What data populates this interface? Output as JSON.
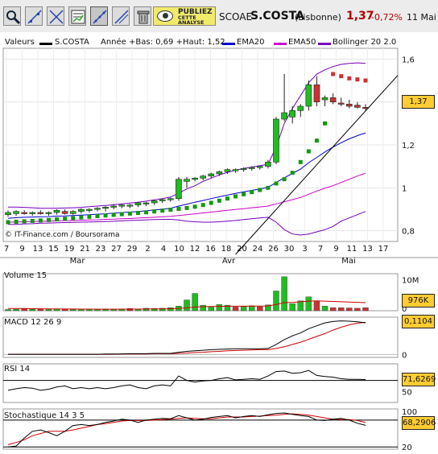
{
  "toolbar": {
    "buttons": [
      {
        "name": "zoom-tool-button",
        "icon": "magnifier-icon",
        "active": false
      },
      {
        "name": "draw-trendline-button",
        "icon": "trendline-icon",
        "active": false
      },
      {
        "name": "draw-cross-line-button",
        "icon": "cross-lines-icon",
        "active": false
      },
      {
        "name": "indicator-chart-button",
        "icon": "chart-percent-icon",
        "active": false
      },
      {
        "name": "trendline-mode-button",
        "icon": "trendline-dots-icon",
        "active": true
      },
      {
        "name": "draw-line-button",
        "icon": "line-icon",
        "active": false
      },
      {
        "name": "delete-button",
        "icon": "trash-icon",
        "active": false
      }
    ],
    "publish_line1": "PUBLIEZ",
    "publish_line2": "CETTE",
    "publish_line3": "ANALYSE"
  },
  "header": {
    "code": "SCOAE",
    "name": "S.COSTA",
    "exchange": "(Lisbonne)",
    "price": "1,37",
    "change": "-0,72%",
    "date": "11 Mai"
  },
  "legend": {
    "valeurs": "Valeurs",
    "series": "S.COSTA",
    "range": "Année +Bas: 0,69 +Haut: 1,52",
    "ema20": "EMA20",
    "ema50": "EMA50",
    "bollinger": "Bollinger 20 2.0"
  },
  "credit": "© IT-Finance.com / Boursorama",
  "colors": {
    "up": "#22bb22",
    "down": "#cc3333",
    "sar_up": "#119911",
    "sar_down": "#cc3333",
    "ema20": "#0000cc",
    "ema50": "#cc00cc",
    "bollinger": "#7700bb",
    "trend": "#000000",
    "vol_ma": "#cc0000",
    "indicator": "#000000",
    "signal": "#cc0000"
  },
  "chart_data": [
    {
      "type": "candlestick",
      "title": "S.COSTA",
      "x_ticks": [
        "7",
        "9",
        "13",
        "15",
        "19",
        "21",
        "23",
        "27",
        "29",
        "2",
        "4",
        "10",
        "12",
        "16",
        "18",
        "20",
        "24",
        "26",
        "30",
        "3",
        "7",
        "9",
        "11",
        "13",
        "17"
      ],
      "months": [
        "Mar",
        "Avr",
        "Mai"
      ],
      "ylim": [
        0.75,
        1.65
      ],
      "y_ticks": [
        "0,8",
        "1",
        "1,2",
        "1,4",
        "1,6"
      ],
      "last_value": "1,37",
      "ohlc": [
        [
          0.875,
          0.895,
          0.865,
          0.885
        ],
        [
          0.88,
          0.895,
          0.87,
          0.89
        ],
        [
          0.885,
          0.895,
          0.875,
          0.88
        ],
        [
          0.88,
          0.89,
          0.87,
          0.885
        ],
        [
          0.885,
          0.895,
          0.875,
          0.88
        ],
        [
          0.88,
          0.89,
          0.87,
          0.885
        ],
        [
          0.885,
          0.9,
          0.875,
          0.895
        ],
        [
          0.89,
          0.9,
          0.875,
          0.88
        ],
        [
          0.88,
          0.895,
          0.875,
          0.89
        ],
        [
          0.89,
          0.905,
          0.88,
          0.9
        ],
        [
          0.895,
          0.905,
          0.885,
          0.9
        ],
        [
          0.9,
          0.91,
          0.89,
          0.905
        ],
        [
          0.905,
          0.915,
          0.89,
          0.91
        ],
        [
          0.91,
          0.925,
          0.9,
          0.915
        ],
        [
          0.915,
          0.925,
          0.905,
          0.92
        ],
        [
          0.915,
          0.925,
          0.905,
          0.92
        ],
        [
          0.92,
          0.935,
          0.91,
          0.93
        ],
        [
          0.925,
          0.935,
          0.915,
          0.93
        ],
        [
          0.93,
          0.945,
          0.92,
          0.94
        ],
        [
          0.94,
          0.95,
          0.93,
          0.945
        ],
        [
          0.945,
          0.955,
          0.935,
          0.95
        ],
        [
          0.95,
          1.05,
          0.94,
          1.04
        ],
        [
          1.03,
          1.05,
          1.0,
          1.04
        ],
        [
          1.04,
          1.05,
          1.03,
          1.045
        ],
        [
          1.045,
          1.06,
          1.035,
          1.055
        ],
        [
          1.055,
          1.07,
          1.045,
          1.065
        ],
        [
          1.065,
          1.08,
          1.055,
          1.075
        ],
        [
          1.075,
          1.09,
          1.065,
          1.085
        ],
        [
          1.08,
          1.09,
          1.07,
          1.085
        ],
        [
          1.085,
          1.095,
          1.075,
          1.09
        ],
        [
          1.09,
          1.1,
          1.08,
          1.095
        ],
        [
          1.095,
          1.1,
          1.085,
          1.1
        ],
        [
          1.1,
          1.13,
          1.09,
          1.12
        ],
        [
          1.12,
          1.33,
          1.11,
          1.32
        ],
        [
          1.32,
          1.53,
          1.31,
          1.35
        ],
        [
          1.33,
          1.38,
          1.3,
          1.36
        ],
        [
          1.36,
          1.39,
          1.33,
          1.38
        ],
        [
          1.38,
          1.5,
          1.36,
          1.48
        ],
        [
          1.48,
          1.52,
          1.38,
          1.4
        ],
        [
          1.41,
          1.43,
          1.38,
          1.42
        ],
        [
          1.42,
          1.44,
          1.39,
          1.4
        ],
        [
          1.395,
          1.42,
          1.38,
          1.39
        ],
        [
          1.39,
          1.41,
          1.37,
          1.38
        ],
        [
          1.385,
          1.4,
          1.37,
          1.375
        ],
        [
          1.375,
          1.39,
          1.36,
          1.37
        ]
      ],
      "sar": [
        0.84,
        0.842,
        0.844,
        0.846,
        0.848,
        0.85,
        0.853,
        0.856,
        0.859,
        0.862,
        0.865,
        0.868,
        0.871,
        0.874,
        0.877,
        0.88,
        0.883,
        0.886,
        0.89,
        0.894,
        0.898,
        0.902,
        0.906,
        0.912,
        0.92,
        0.93,
        0.94,
        0.95,
        0.96,
        0.97,
        0.98,
        0.99,
        1.0,
        1.02,
        1.04,
        1.07,
        1.12,
        1.17,
        1.22,
        1.3,
        1.53,
        1.52,
        1.51,
        1.505,
        1.5
      ],
      "ema20": [
        0.858,
        0.861,
        0.863,
        0.864,
        0.865,
        0.866,
        0.868,
        0.869,
        0.871,
        0.873,
        0.875,
        0.877,
        0.879,
        0.882,
        0.885,
        0.887,
        0.89,
        0.893,
        0.897,
        0.9,
        0.905,
        0.915,
        0.924,
        0.933,
        0.941,
        0.95,
        0.958,
        0.966,
        0.974,
        0.981,
        0.988,
        0.995,
        1.002,
        1.025,
        1.047,
        1.067,
        1.087,
        1.117,
        1.142,
        1.167,
        1.19,
        1.21,
        1.228,
        1.243,
        1.256
      ],
      "ema50": [
        0.84,
        0.841,
        0.842,
        0.843,
        0.844,
        0.845,
        0.846,
        0.847,
        0.848,
        0.849,
        0.85,
        0.851,
        0.853,
        0.854,
        0.856,
        0.857,
        0.859,
        0.861,
        0.863,
        0.865,
        0.867,
        0.871,
        0.875,
        0.879,
        0.883,
        0.887,
        0.891,
        0.895,
        0.899,
        0.903,
        0.907,
        0.911,
        0.915,
        0.925,
        0.935,
        0.945,
        0.955,
        0.97,
        0.985,
        0.998,
        1.01,
        1.025,
        1.04,
        1.055,
        1.068
      ],
      "bollinger_upper": [
        0.91,
        0.91,
        0.909,
        0.907,
        0.905,
        0.905,
        0.905,
        0.906,
        0.907,
        0.909,
        0.912,
        0.915,
        0.918,
        0.921,
        0.925,
        0.929,
        0.933,
        0.938,
        0.944,
        0.95,
        0.957,
        0.975,
        0.995,
        1.01,
        1.03,
        1.045,
        1.06,
        1.072,
        1.082,
        1.09,
        1.097,
        1.103,
        1.11,
        1.19,
        1.3,
        1.37,
        1.43,
        1.49,
        1.53,
        1.55,
        1.565,
        1.575,
        1.58,
        1.582,
        1.58
      ],
      "bollinger_lower": [
        0.83,
        0.83,
        0.832,
        0.833,
        0.835,
        0.836,
        0.837,
        0.838,
        0.839,
        0.84,
        0.841,
        0.842,
        0.843,
        0.844,
        0.846,
        0.848,
        0.849,
        0.851,
        0.852,
        0.853,
        0.853,
        0.85,
        0.845,
        0.842,
        0.84,
        0.84,
        0.842,
        0.845,
        0.848,
        0.852,
        0.856,
        0.86,
        0.863,
        0.84,
        0.805,
        0.785,
        0.78,
        0.785,
        0.795,
        0.805,
        0.82,
        0.845,
        0.86,
        0.875,
        0.89
      ],
      "trendline": [
        [
          28,
          0.69
        ],
        [
          45,
          1.4
        ]
      ]
    },
    {
      "type": "bar",
      "title": "Volume 15",
      "y_ticks": [
        "10M",
        "0"
      ],
      "ylim": [
        0,
        12000000
      ],
      "last_value": "976K",
      "values": [
        400000,
        500000,
        600000,
        500000,
        500000,
        400000,
        600000,
        500000,
        400000,
        500000,
        500000,
        500000,
        600000,
        500000,
        600000,
        700000,
        600000,
        800000,
        700000,
        800000,
        1000000,
        1500000,
        3500000,
        5600000,
        1800000,
        1400000,
        2000000,
        1800000,
        1200000,
        1400000,
        1600000,
        1300000,
        1900000,
        6400000,
        11000000,
        2300000,
        3200000,
        4500000,
        3000000,
        1500000,
        1000000,
        1000000,
        900000,
        800000,
        976000
      ],
      "direction": [
        1,
        1,
        0,
        1,
        0,
        1,
        1,
        0,
        1,
        1,
        1,
        1,
        1,
        1,
        1,
        0,
        1,
        1,
        1,
        1,
        1,
        1,
        1,
        1,
        1,
        1,
        1,
        1,
        0,
        1,
        1,
        0,
        1,
        1,
        1,
        1,
        1,
        1,
        0,
        1,
        0,
        0,
        0,
        0,
        0
      ],
      "ma": [
        700000,
        700000,
        700000,
        650000,
        620000,
        600000,
        580000,
        560000,
        540000,
        520000,
        510000,
        500000,
        500000,
        500000,
        510000,
        520000,
        530000,
        550000,
        570000,
        600000,
        650000,
        750000,
        950000,
        1200000,
        1300000,
        1350000,
        1400000,
        1450000,
        1450000,
        1450000,
        1500000,
        1500000,
        1550000,
        2000000,
        2600000,
        2700000,
        2900000,
        3100000,
        3200000,
        3100000,
        3000000,
        2900000,
        2800000,
        2700000,
        2600000
      ]
    },
    {
      "type": "line",
      "title": "MACD 12 26 9",
      "y_ticks": [
        "0"
      ],
      "ylim": [
        -0.01,
        0.13
      ],
      "last_value": "0,1104",
      "macd": [
        0.001,
        0.001,
        0.001,
        0.001,
        0.001,
        0.001,
        0.001,
        0.001,
        0.001,
        0.001,
        0.001,
        0.001,
        0.002,
        0.002,
        0.002,
        0.003,
        0.003,
        0.003,
        0.004,
        0.004,
        0.004,
        0.008,
        0.011,
        0.013,
        0.015,
        0.017,
        0.018,
        0.019,
        0.02,
        0.02,
        0.02,
        0.02,
        0.021,
        0.035,
        0.052,
        0.065,
        0.075,
        0.09,
        0.1,
        0.11,
        0.115,
        0.117,
        0.116,
        0.114,
        0.1104
      ],
      "signal": [
        0.001,
        0.001,
        0.001,
        0.001,
        0.001,
        0.001,
        0.001,
        0.001,
        0.001,
        0.001,
        0.001,
        0.001,
        0.001,
        0.001,
        0.002,
        0.002,
        0.002,
        0.002,
        0.003,
        0.003,
        0.003,
        0.004,
        0.005,
        0.007,
        0.008,
        0.01,
        0.011,
        0.013,
        0.014,
        0.015,
        0.016,
        0.017,
        0.017,
        0.021,
        0.027,
        0.035,
        0.043,
        0.053,
        0.063,
        0.073,
        0.085,
        0.095,
        0.103,
        0.109,
        0.112
      ]
    },
    {
      "type": "line",
      "title": "RSI 14",
      "y_ticks": [
        "50"
      ],
      "ylim": [
        30,
        100
      ],
      "threshold": 70,
      "last_value": "71,6269",
      "values": [
        52,
        55,
        57,
        56,
        52,
        54,
        58,
        60,
        55,
        57,
        55,
        57,
        55,
        57,
        60,
        62,
        57,
        55,
        60,
        62,
        60,
        78,
        70,
        67,
        69,
        70,
        73,
        75,
        71,
        72,
        73,
        72,
        78,
        86,
        87,
        83,
        84,
        88,
        79,
        77,
        76,
        73,
        72,
        72,
        71.6
      ]
    },
    {
      "type": "line",
      "title": "Stochastique 14 3 5",
      "y_ticks": [
        "100",
        "20"
      ],
      "ylim": [
        15,
        105
      ],
      "thresholds": [
        20,
        80
      ],
      "last_value": "68,2906",
      "k": [
        20,
        22,
        40,
        55,
        58,
        52,
        45,
        55,
        68,
        70,
        68,
        70,
        75,
        78,
        82,
        80,
        75,
        80,
        82,
        84,
        83,
        90,
        85,
        80,
        82,
        86,
        88,
        90,
        85,
        88,
        90,
        88,
        92,
        95,
        96,
        93,
        90,
        88,
        80,
        79,
        82,
        84,
        80,
        73,
        68.3
      ],
      "d": [
        25,
        30,
        36,
        45,
        50,
        55,
        55,
        55,
        58,
        62,
        66,
        70,
        72,
        75,
        78,
        79,
        79,
        79,
        80,
        81,
        82,
        84,
        85,
        84,
        83,
        83,
        85,
        87,
        87,
        87,
        88,
        89,
        90,
        91,
        93,
        94,
        93,
        91,
        88,
        85,
        82,
        81,
        81,
        79,
        75
      ]
    }
  ]
}
